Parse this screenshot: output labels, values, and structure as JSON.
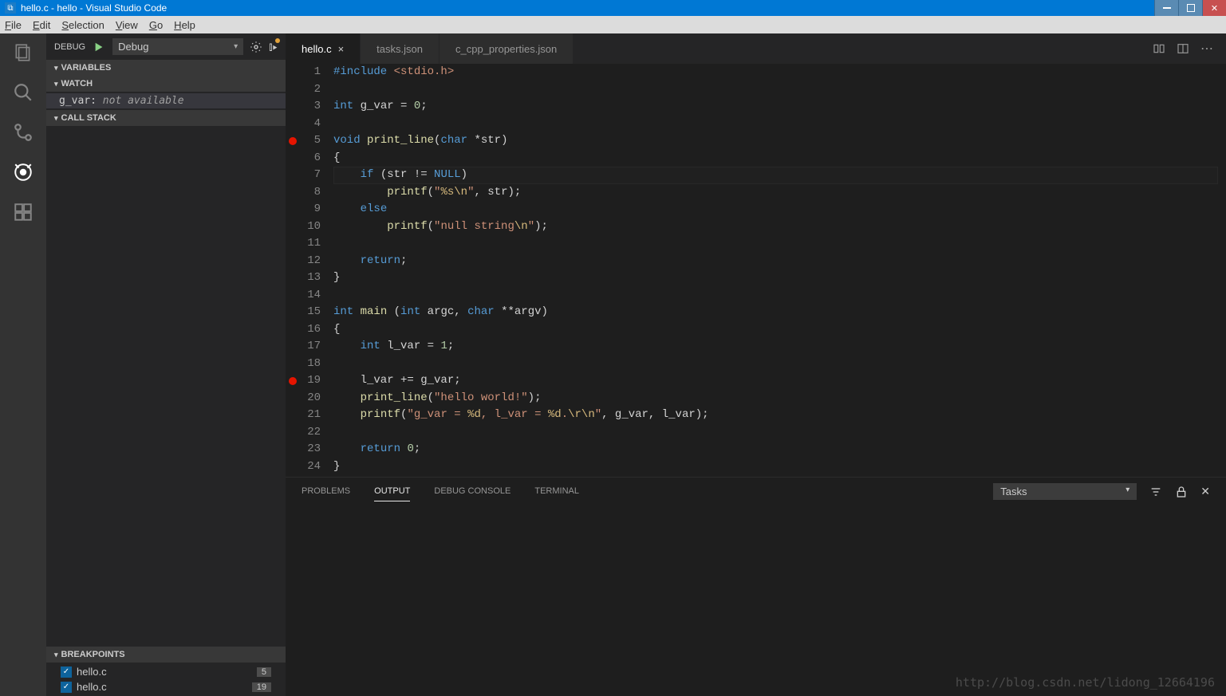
{
  "titlebar": {
    "title": "hello.c - hello - Visual Studio Code"
  },
  "menubar": [
    "File",
    "Edit",
    "Selection",
    "View",
    "Go",
    "Help"
  ],
  "debug": {
    "label": "DEBUG",
    "config": "Debug"
  },
  "sidebar": {
    "variables": "VARIABLES",
    "watch": "WATCH",
    "watchItems": [
      {
        "name": "g_var:",
        "value": "not available"
      }
    ],
    "callstack": "CALL STACK",
    "breakpoints": "BREAKPOINTS",
    "bpItems": [
      {
        "file": "hello.c",
        "line": "5"
      },
      {
        "file": "hello.c",
        "line": "19"
      }
    ]
  },
  "tabs": [
    {
      "name": "hello.c",
      "active": true
    },
    {
      "name": "tasks.json",
      "active": false
    },
    {
      "name": "c_cpp_properties.json",
      "active": false
    }
  ],
  "editor": {
    "currentLine": 7,
    "breakpoints": [
      5,
      19
    ],
    "lines": [
      {
        "n": 1,
        "tokens": [
          [
            "kw",
            "#include"
          ],
          [
            "op",
            " "
          ],
          [
            "str",
            "<stdio.h>"
          ]
        ]
      },
      {
        "n": 2,
        "tokens": []
      },
      {
        "n": 3,
        "tokens": [
          [
            "type",
            "int"
          ],
          [
            "op",
            " g_var = "
          ],
          [
            "num",
            "0"
          ],
          [
            "op",
            ";"
          ]
        ]
      },
      {
        "n": 4,
        "tokens": []
      },
      {
        "n": 5,
        "tokens": [
          [
            "type",
            "void"
          ],
          [
            "op",
            " "
          ],
          [
            "fn",
            "print_line"
          ],
          [
            "br",
            "("
          ],
          [
            "type",
            "char"
          ],
          [
            "op",
            " *str"
          ],
          [
            "br",
            ")"
          ]
        ]
      },
      {
        "n": 6,
        "tokens": [
          [
            "br",
            "{"
          ]
        ]
      },
      {
        "n": 7,
        "tokens": [
          [
            "op",
            "    "
          ],
          [
            "kw",
            "if"
          ],
          [
            "op",
            " "
          ],
          [
            "br",
            "("
          ],
          [
            "op",
            "str != "
          ],
          [
            "const",
            "NULL"
          ],
          [
            "br",
            ")"
          ]
        ]
      },
      {
        "n": 8,
        "tokens": [
          [
            "op",
            "        "
          ],
          [
            "fn",
            "printf"
          ],
          [
            "br",
            "("
          ],
          [
            "str",
            "\""
          ],
          [
            "esc",
            "%s\\n"
          ],
          [
            "str",
            "\""
          ],
          [
            "op",
            ", str"
          ],
          [
            "br",
            ")"
          ],
          [
            "op",
            ";"
          ]
        ]
      },
      {
        "n": 9,
        "tokens": [
          [
            "op",
            "    "
          ],
          [
            "kw",
            "else"
          ]
        ]
      },
      {
        "n": 10,
        "tokens": [
          [
            "op",
            "        "
          ],
          [
            "fn",
            "printf"
          ],
          [
            "br",
            "("
          ],
          [
            "str",
            "\"null string"
          ],
          [
            "esc",
            "\\n"
          ],
          [
            "str",
            "\""
          ],
          [
            "br",
            ")"
          ],
          [
            "op",
            ";"
          ]
        ]
      },
      {
        "n": 11,
        "tokens": []
      },
      {
        "n": 12,
        "tokens": [
          [
            "op",
            "    "
          ],
          [
            "kw",
            "return"
          ],
          [
            "op",
            ";"
          ]
        ]
      },
      {
        "n": 13,
        "tokens": [
          [
            "br",
            "}"
          ]
        ]
      },
      {
        "n": 14,
        "tokens": []
      },
      {
        "n": 15,
        "tokens": [
          [
            "type",
            "int"
          ],
          [
            "op",
            " "
          ],
          [
            "fn",
            "main"
          ],
          [
            "op",
            " "
          ],
          [
            "br",
            "("
          ],
          [
            "type",
            "int"
          ],
          [
            "op",
            " argc, "
          ],
          [
            "type",
            "char"
          ],
          [
            "op",
            " **argv"
          ],
          [
            "br",
            ")"
          ]
        ]
      },
      {
        "n": 16,
        "tokens": [
          [
            "br",
            "{"
          ]
        ]
      },
      {
        "n": 17,
        "tokens": [
          [
            "op",
            "    "
          ],
          [
            "type",
            "int"
          ],
          [
            "op",
            " l_var = "
          ],
          [
            "num",
            "1"
          ],
          [
            "op",
            ";"
          ]
        ]
      },
      {
        "n": 18,
        "tokens": []
      },
      {
        "n": 19,
        "tokens": [
          [
            "op",
            "    l_var += g_var;"
          ]
        ]
      },
      {
        "n": 20,
        "tokens": [
          [
            "op",
            "    "
          ],
          [
            "fn",
            "print_line"
          ],
          [
            "br",
            "("
          ],
          [
            "str",
            "\"hello world!\""
          ],
          [
            "br",
            ")"
          ],
          [
            "op",
            ";"
          ]
        ]
      },
      {
        "n": 21,
        "tokens": [
          [
            "op",
            "    "
          ],
          [
            "fn",
            "printf"
          ],
          [
            "br",
            "("
          ],
          [
            "str",
            "\"g_var = "
          ],
          [
            "esc",
            "%d"
          ],
          [
            "str",
            ", l_var = "
          ],
          [
            "esc",
            "%d"
          ],
          [
            "str",
            "."
          ],
          [
            "esc",
            "\\r\\n"
          ],
          [
            "str",
            "\""
          ],
          [
            "op",
            ", g_var, l_var"
          ],
          [
            "br",
            ")"
          ],
          [
            "op",
            ";"
          ]
        ]
      },
      {
        "n": 22,
        "tokens": []
      },
      {
        "n": 23,
        "tokens": [
          [
            "op",
            "    "
          ],
          [
            "kw",
            "return"
          ],
          [
            "op",
            " "
          ],
          [
            "num",
            "0"
          ],
          [
            "op",
            ";"
          ]
        ]
      },
      {
        "n": 24,
        "tokens": [
          [
            "br",
            "}"
          ]
        ]
      }
    ]
  },
  "panel": {
    "tabs": [
      "PROBLEMS",
      "OUTPUT",
      "DEBUG CONSOLE",
      "TERMINAL"
    ],
    "active": "OUTPUT",
    "select": "Tasks"
  },
  "watermark": "http://blog.csdn.net/lidong_12664196"
}
